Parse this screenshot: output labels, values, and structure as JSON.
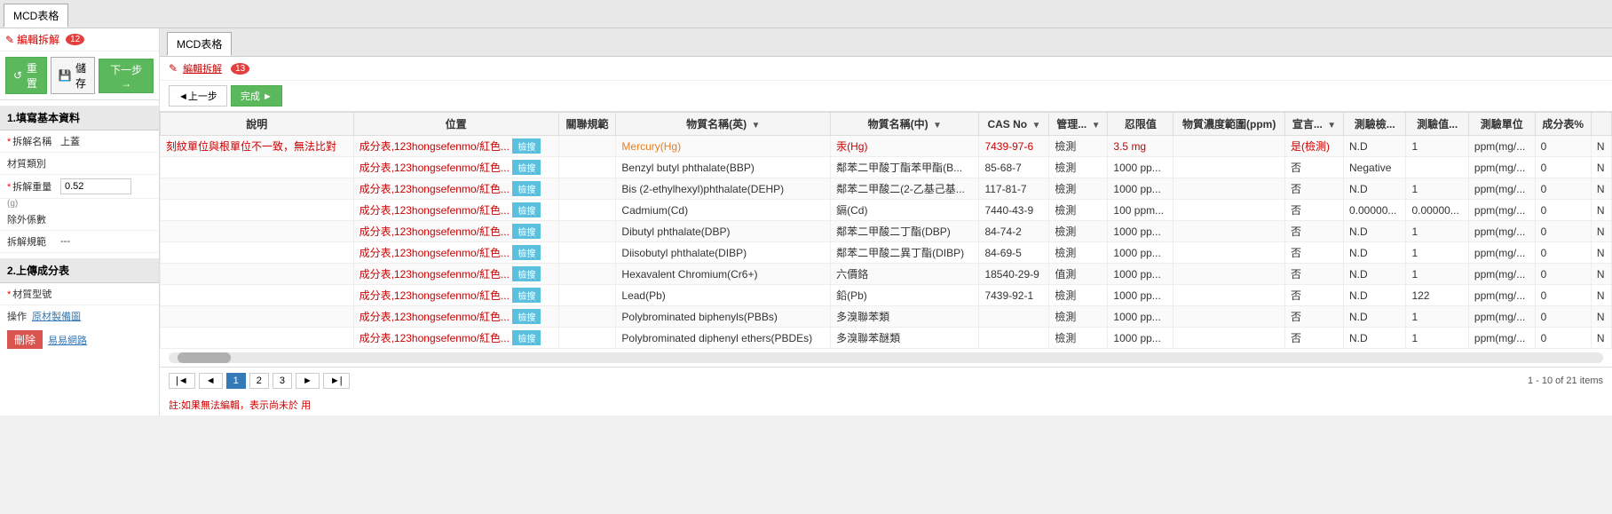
{
  "tabs": [
    {
      "id": "mcd",
      "label": "MCD表格",
      "active": true,
      "badge": null
    },
    {
      "id": "mcd2",
      "label": "MCD表格",
      "active": false,
      "badge": null
    }
  ],
  "leftPanel": {
    "editLink": "編輯拆解",
    "editBadge": "12",
    "toolbar": {
      "resetLabel": "重置",
      "saveLabel": "儲存",
      "nextLabel": "下一步 →"
    },
    "section1Title": "1.填寫基本資料",
    "fields": [
      {
        "label": "*拆解名稱",
        "required": true,
        "value": "上蓋",
        "type": "text"
      },
      {
        "label": "材質類別",
        "required": false,
        "value": "",
        "type": "text"
      },
      {
        "label": "*拆解重量",
        "required": true,
        "value": "0.52",
        "type": "input",
        "subLabel": "(g)"
      },
      {
        "label": "除外係數",
        "required": false,
        "value": "",
        "type": "text"
      },
      {
        "label": "拆解規範",
        "required": false,
        "value": "---",
        "type": "text"
      }
    ],
    "section2Title": "2.上傳成分表",
    "materialFields": [
      {
        "label": "材質型號",
        "required": true,
        "value": ""
      }
    ],
    "operations": [
      {
        "label": "操作",
        "actionLabel": "原材製備圖"
      },
      {
        "label": "刪除",
        "linkLabel": "易易網路"
      }
    ]
  },
  "rightPanel": {
    "title": "MCD表格",
    "editLink": "編輯拆解",
    "editBadge": "13",
    "prevLabel": "◄上一步",
    "completeLabel": "完成 ►",
    "table": {
      "columns": [
        {
          "id": "description",
          "label": "說明",
          "filterable": false
        },
        {
          "id": "location",
          "label": "位置",
          "filterable": false
        },
        {
          "id": "queryType",
          "label": "關聯規範",
          "filterable": false
        },
        {
          "id": "nameEn",
          "label": "物質名稱(英)",
          "filterable": true
        },
        {
          "id": "nameCn",
          "label": "物質名稱(中)",
          "filterable": true
        },
        {
          "id": "casNo",
          "label": "CAS No",
          "filterable": true
        },
        {
          "id": "mgmt",
          "label": "管理...",
          "filterable": true
        },
        {
          "id": "threshold",
          "label": "忍限值",
          "filterable": false
        },
        {
          "id": "concentration",
          "label": "物質濃度範圍(ppm)",
          "filterable": false
        },
        {
          "id": "declare",
          "label": "宣言...",
          "filterable": true
        },
        {
          "id": "testResult",
          "label": "測驗檢...",
          "filterable": false
        },
        {
          "id": "testValue",
          "label": "測驗值...",
          "filterable": false
        },
        {
          "id": "testUnit",
          "label": "測驗單位",
          "filterable": false
        },
        {
          "id": "percentage",
          "label": "成分表%",
          "filterable": false
        },
        {
          "id": "extra",
          "label": "",
          "filterable": false
        }
      ],
      "rows": [
        {
          "description": "刻紋單位與根單位不一致，無法比對",
          "descColor": "red",
          "location": "成分表,123hongsefenmo/紅色...",
          "queryBtn": "檢搜",
          "nameEn": "Mercury(Hg)",
          "nameEnColor": "orange",
          "nameCn": "汞(Hg)",
          "nameCnColor": "red",
          "casNo": "7439-97-6",
          "casColor": "red",
          "mgmt": "檢測",
          "threshold": "3.5 mg",
          "thresholdColor": "red",
          "concentration": "",
          "declare": "是(檢測)",
          "declareColor": "red",
          "testResult": "N.D",
          "testValue": "1",
          "testUnit": "ppm(mg/...",
          "percentage": "0",
          "extra": "N"
        },
        {
          "description": "",
          "descColor": "",
          "location": "成分表,123hongsefenmo/紅色...",
          "queryBtn": "檢搜",
          "nameEn": "Benzyl butyl phthalate(BBP)",
          "nameEnColor": "",
          "nameCn": "鄰苯二甲酸丁酯苯甲酯(B...",
          "nameCnColor": "",
          "casNo": "85-68-7",
          "casColor": "",
          "mgmt": "檢測",
          "threshold": "1000 pp...",
          "thresholdColor": "",
          "concentration": "",
          "declare": "否",
          "declareColor": "",
          "testResult": "Negative",
          "testValue": "",
          "testUnit": "ppm(mg/...",
          "percentage": "0",
          "extra": "N"
        },
        {
          "description": "",
          "location": "成分表,123hongsefenmo/紅色...",
          "queryBtn": "檢搜",
          "nameEn": "Bis (2-ethylhexyl)phthalate(DEHP)",
          "nameCn": "鄰苯二甲酸二(2-乙基己基...",
          "casNo": "117-81-7",
          "mgmt": "檢測",
          "threshold": "1000 pp...",
          "concentration": "",
          "declare": "否",
          "testResult": "N.D",
          "testValue": "1",
          "testUnit": "ppm(mg/...",
          "percentage": "0",
          "extra": "N"
        },
        {
          "description": "",
          "location": "成分表,123hongsefenmo/紅色...",
          "queryBtn": "檢搜",
          "nameEn": "Cadmium(Cd)",
          "nameCn": "鎘(Cd)",
          "casNo": "7440-43-9",
          "mgmt": "檢測",
          "threshold": "100 ppm...",
          "concentration": "",
          "declare": "否",
          "testResult": "0.00000...",
          "testValue": "0.00000...",
          "testUnit": "ppm(mg/...",
          "percentage": "0",
          "extra": "N"
        },
        {
          "description": "",
          "location": "成分表,123hongsefenmo/紅色...",
          "queryBtn": "檢搜",
          "nameEn": "Dibutyl phthalate(DBP)",
          "nameCn": "鄰苯二甲酸二丁酯(DBP)",
          "casNo": "84-74-2",
          "mgmt": "檢測",
          "threshold": "1000 pp...",
          "concentration": "",
          "declare": "否",
          "testResult": "N.D",
          "testValue": "1",
          "testUnit": "ppm(mg/...",
          "percentage": "0",
          "extra": "N"
        },
        {
          "description": "",
          "location": "成分表,123hongsefenmo/紅色...",
          "queryBtn": "檢搜",
          "nameEn": "Diisobutyl phthalate(DIBP)",
          "nameCn": "鄰苯二甲酸二異丁酯(DIBP)",
          "casNo": "84-69-5",
          "mgmt": "檢測",
          "threshold": "1000 pp...",
          "concentration": "",
          "declare": "否",
          "testResult": "N.D",
          "testValue": "1",
          "testUnit": "ppm(mg/...",
          "percentage": "0",
          "extra": "N"
        },
        {
          "description": "",
          "location": "成分表,123hongsefenmo/紅色...",
          "queryBtn": "檢搜",
          "nameEn": "Hexavalent Chromium(Cr6+)",
          "nameCn": "六價鉻",
          "casNo": "18540-29-9",
          "mgmt": "值測",
          "threshold": "1000 pp...",
          "concentration": "",
          "declare": "否",
          "testResult": "N.D",
          "testValue": "1",
          "testUnit": "ppm(mg/...",
          "percentage": "0",
          "extra": "N"
        },
        {
          "description": "",
          "location": "成分表,123hongsefenmo/紅色...",
          "queryBtn": "檢搜",
          "nameEn": "Lead(Pb)",
          "nameCn": "鉛(Pb)",
          "casNo": "7439-92-1",
          "mgmt": "檢測",
          "threshold": "1000 pp...",
          "concentration": "",
          "declare": "否",
          "testResult": "N.D",
          "testValue": "122",
          "testUnit": "ppm(mg/...",
          "percentage": "0",
          "extra": "N"
        },
        {
          "description": "",
          "location": "成分表,123hongsefenmo/紅色...",
          "queryBtn": "檢搜",
          "nameEn": "Polybrominated biphenyls(PBBs)",
          "nameCn": "多溴聯苯類",
          "casNo": "",
          "mgmt": "檢測",
          "threshold": "1000 pp...",
          "concentration": "",
          "declare": "否",
          "testResult": "N.D",
          "testValue": "1",
          "testUnit": "ppm(mg/...",
          "percentage": "0",
          "extra": "N"
        },
        {
          "description": "",
          "location": "成分表,123hongsefenmo/紅色...",
          "queryBtn": "檢搜",
          "nameEn": "Polybrominated diphenyl ethers(PBDEs)",
          "nameCn": "多溴聯苯醚類",
          "casNo": "",
          "mgmt": "檢測",
          "threshold": "1000 pp...",
          "concentration": "",
          "declare": "否",
          "testResult": "N.D",
          "testValue": "1",
          "testUnit": "ppm(mg/...",
          "percentage": "0",
          "extra": "N"
        }
      ]
    },
    "pagination": {
      "pages": [
        1,
        2,
        3
      ],
      "currentPage": 1,
      "totalInfo": "1 - 10 of 21 items"
    },
    "note": "註:如果無法編輯，表示尚未於 用"
  }
}
